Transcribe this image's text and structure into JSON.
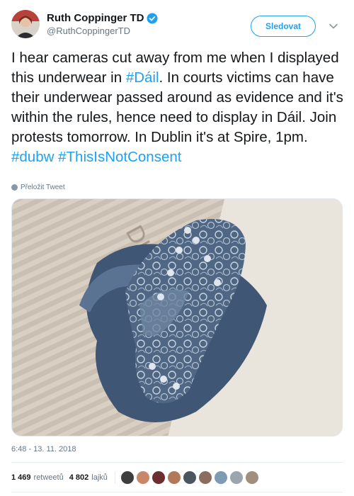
{
  "tweet": {
    "author": {
      "display_name": "Ruth Coppinger TD",
      "handle": "@RuthCoppingerTD",
      "verified_icon": "verified-badge-icon"
    },
    "follow_label": "Sledovat",
    "text_segments": [
      {
        "text": "I hear cameras cut away from me when I displayed this underwear in ",
        "type": "plain"
      },
      {
        "text": "#Dáil",
        "type": "hashtag"
      },
      {
        "text": ". In courts victims can have their underwear passed around as evidence and it's within the rules, hence need to display in Dáil. Join protests tomorrow. In Dublin it's at Spire, 1pm. ",
        "type": "plain"
      },
      {
        "text": "#dubw",
        "type": "hashtag"
      },
      {
        "text": " ",
        "type": "plain"
      },
      {
        "text": "#ThisIsNotConsent",
        "type": "hashtag"
      }
    ],
    "translate_label": "Přeložit Tweet",
    "timestamp": "6:48 - 13. 11. 2018",
    "retweets": {
      "count": "1 469",
      "label": "retweetů"
    },
    "likes": {
      "count": "4 802",
      "label": "lajků"
    },
    "liker_avatar_colors": [
      "#3d3d3d",
      "#c9876a",
      "#6b2f2f",
      "#b07a5a",
      "#4a5560",
      "#8a6d5c",
      "#7f9bb3",
      "#9aa5ad",
      "#a08f7e"
    ]
  },
  "colors": {
    "accent": "#1da1f2",
    "text": "#14171a",
    "secondary": "#657786"
  }
}
